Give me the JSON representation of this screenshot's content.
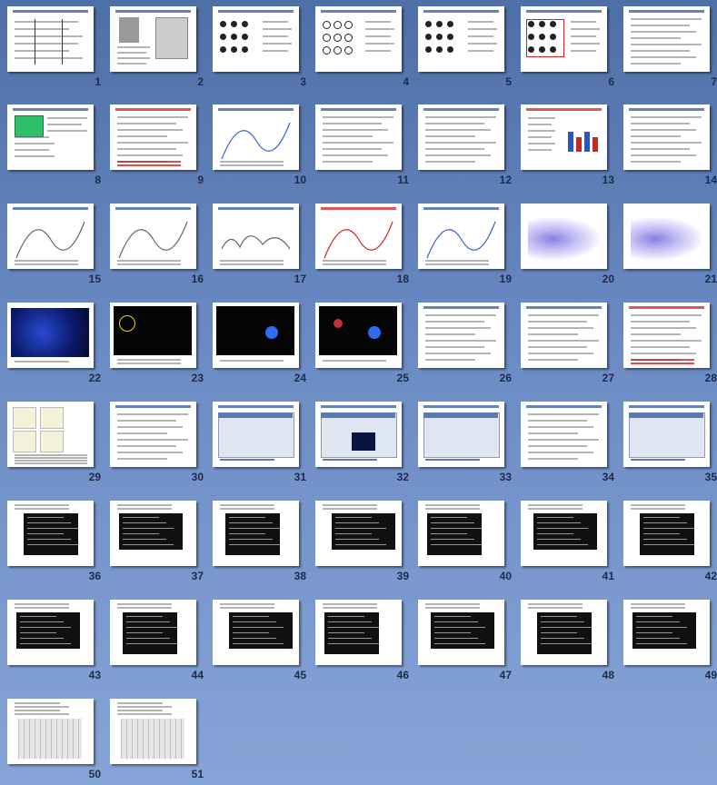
{
  "slides": [
    {
      "number": "1",
      "kind": "table"
    },
    {
      "number": "2",
      "kind": "portrait"
    },
    {
      "number": "3",
      "kind": "dots"
    },
    {
      "number": "4",
      "kind": "rings"
    },
    {
      "number": "5",
      "kind": "dots"
    },
    {
      "number": "6",
      "kind": "dots-red"
    },
    {
      "number": "7",
      "kind": "text-table"
    },
    {
      "number": "8",
      "kind": "green-box"
    },
    {
      "number": "9",
      "kind": "text-red"
    },
    {
      "number": "10",
      "kind": "curve"
    },
    {
      "number": "11",
      "kind": "formula"
    },
    {
      "number": "12",
      "kind": "formula"
    },
    {
      "number": "13",
      "kind": "bars"
    },
    {
      "number": "14",
      "kind": "text"
    },
    {
      "number": "15",
      "kind": "graph"
    },
    {
      "number": "16",
      "kind": "graph"
    },
    {
      "number": "17",
      "kind": "terrain"
    },
    {
      "number": "18",
      "kind": "curve-red"
    },
    {
      "number": "19",
      "kind": "curve-blue"
    },
    {
      "number": "20",
      "kind": "surface"
    },
    {
      "number": "21",
      "kind": "surface"
    },
    {
      "number": "22",
      "kind": "blue-noise"
    },
    {
      "number": "23",
      "kind": "black-yellow"
    },
    {
      "number": "24",
      "kind": "black-blue"
    },
    {
      "number": "25",
      "kind": "black-blue-red"
    },
    {
      "number": "26",
      "kind": "text"
    },
    {
      "number": "27",
      "kind": "text"
    },
    {
      "number": "28",
      "kind": "text-red"
    },
    {
      "number": "29",
      "kind": "scatter"
    },
    {
      "number": "30",
      "kind": "text"
    },
    {
      "number": "31",
      "kind": "website"
    },
    {
      "number": "32",
      "kind": "website"
    },
    {
      "number": "33",
      "kind": "webpage"
    },
    {
      "number": "34",
      "kind": "text"
    },
    {
      "number": "35",
      "kind": "screenshot"
    },
    {
      "number": "36",
      "kind": "terminal"
    },
    {
      "number": "37",
      "kind": "terminal"
    },
    {
      "number": "38",
      "kind": "terminal"
    },
    {
      "number": "39",
      "kind": "terminal"
    },
    {
      "number": "40",
      "kind": "terminal"
    },
    {
      "number": "41",
      "kind": "terminal"
    },
    {
      "number": "42",
      "kind": "terminal"
    },
    {
      "number": "43",
      "kind": "terminal"
    },
    {
      "number": "44",
      "kind": "terminal"
    },
    {
      "number": "45",
      "kind": "terminal"
    },
    {
      "number": "46",
      "kind": "terminal"
    },
    {
      "number": "47",
      "kind": "terminal"
    },
    {
      "number": "48",
      "kind": "terminal"
    },
    {
      "number": "49",
      "kind": "terminal"
    },
    {
      "number": "50",
      "kind": "table-grey"
    },
    {
      "number": "51",
      "kind": "table-grey"
    }
  ],
  "colors": {
    "background_top": "#4f6fa8",
    "background_bottom": "#86a4d6",
    "slide_number": "#1d2b48",
    "accent_red": "#d42020",
    "accent_blue": "#345a9a"
  }
}
